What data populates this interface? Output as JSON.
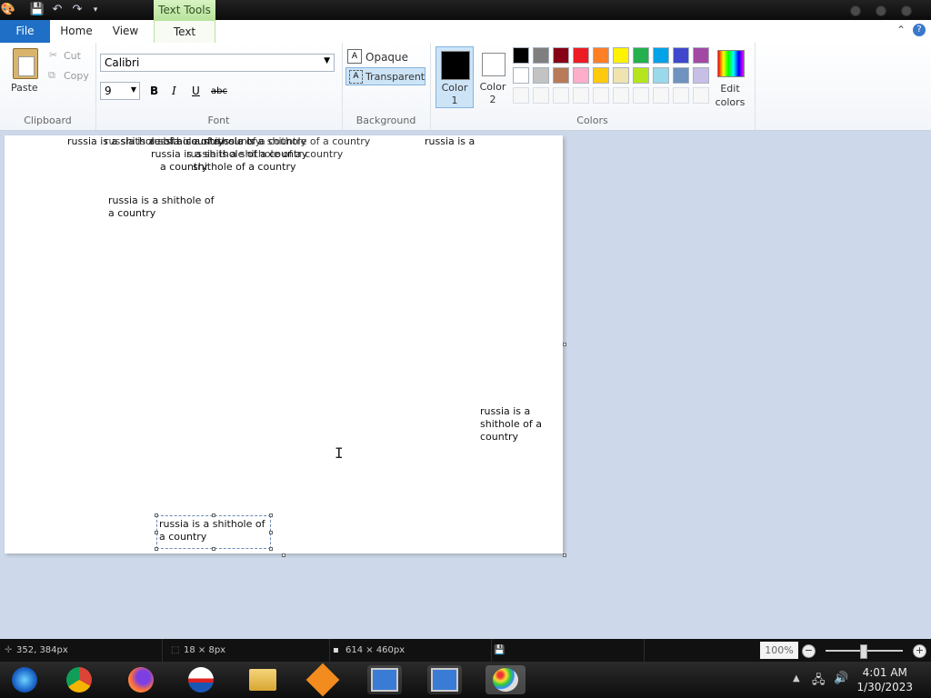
{
  "title_bar": {
    "context_tab": "Text Tools"
  },
  "tabs": {
    "file": "File",
    "home": "Home",
    "view": "View",
    "text": "Text"
  },
  "clipboard": {
    "paste": "Paste",
    "cut": "Cut",
    "copy": "Copy",
    "label": "Clipboard"
  },
  "font": {
    "family": "Calibri",
    "size": "9",
    "bold": "B",
    "italic": "I",
    "underline": "U",
    "strike": "abc",
    "label": "Font"
  },
  "background": {
    "opaque": "Opaque",
    "transparent": "Transparent",
    "label": "Background"
  },
  "colors": {
    "color1": "Color",
    "color1_num": "1",
    "color2": "Color",
    "color2_num": "2",
    "edit": "Edit",
    "edit2": "colors",
    "label": "Colors",
    "palette_row1": [
      "#000000",
      "#7f7f7f",
      "#880015",
      "#ed1c24",
      "#ff7f27",
      "#fff200",
      "#22b14c",
      "#00a2e8",
      "#3f48cc",
      "#a349a4"
    ],
    "palette_row2": [
      "#ffffff",
      "#c3c3c3",
      "#b97a57",
      "#ffaec9",
      "#ffc90e",
      "#efe4b0",
      "#b5e61d",
      "#99d9ea",
      "#7092be",
      "#c8bfe7"
    ]
  },
  "canvas_texts": {
    "t1": "russia is a shithole of a country",
    "t2": "russia is a",
    "t3": "a country",
    "t4": "shithole of a country",
    "t5": "russia is a shithole of",
    "t6": "a country",
    "t7": "russia is a",
    "t8": "shithole of a",
    "t9": "country",
    "t10": "russia is a shithole of",
    "t11": "a country"
  },
  "status": {
    "cursor": "352, 384px",
    "selection": "18 × 8px",
    "size": "614 × 460px",
    "zoom": "100%"
  },
  "clock": {
    "time": "4:01 AM",
    "date": "1/30/2023"
  }
}
